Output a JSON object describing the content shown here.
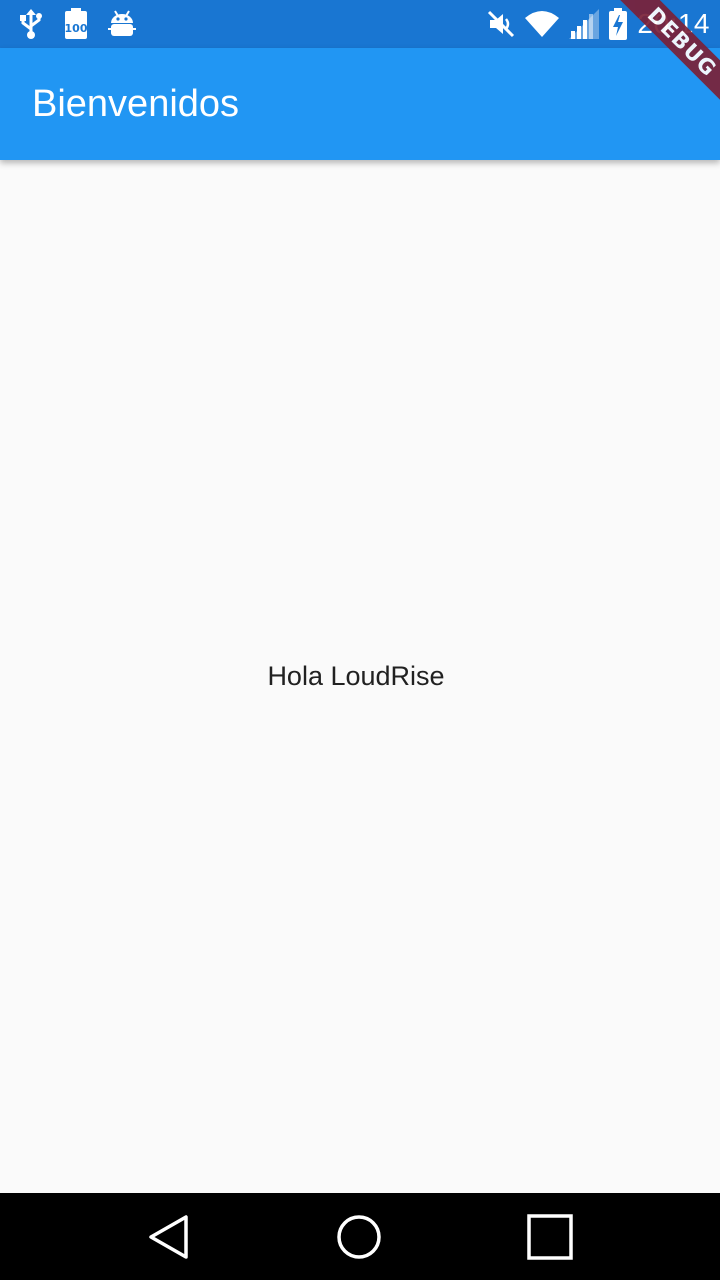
{
  "status_bar": {
    "left_icons": [
      "usb-icon",
      "battery-100-icon",
      "android-debug-icon"
    ],
    "battery_badge": "100",
    "right_icons": [
      "mute-icon",
      "wifi-icon",
      "signal-icon",
      "battery-charging-icon"
    ],
    "time": "20:14"
  },
  "app_bar": {
    "title": "Bienvenidos",
    "color": "#2196f3"
  },
  "debug_banner": {
    "label": "DEBUG",
    "color": "#7a2138"
  },
  "body": {
    "text": "Hola LoudRise"
  },
  "nav_bar": {
    "buttons": [
      "back-icon",
      "home-icon",
      "recents-icon"
    ]
  }
}
